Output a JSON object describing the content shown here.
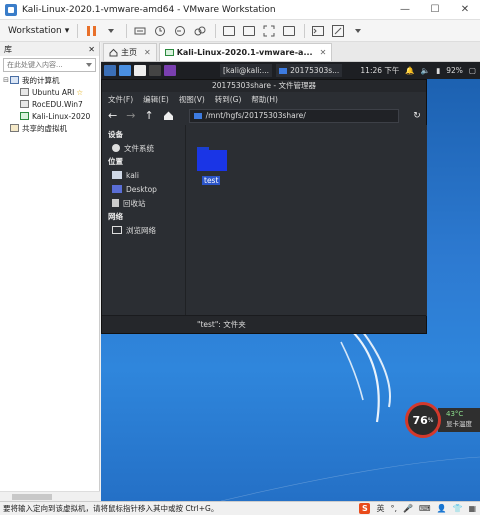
{
  "window": {
    "title": "Kali-Linux-2020.1-vmware-amd64 - VMware Workstation",
    "controls": [
      "—",
      "☐",
      "✕"
    ]
  },
  "toolbar": {
    "menu_label": "Workstation",
    "menu_arrow": "▾"
  },
  "library": {
    "title": "库",
    "close": "✕",
    "search_placeholder": "在此处键入内容...",
    "my_computer": "我的计算机",
    "vms": [
      "Ubuntu ARI",
      "RocEDU.Win7",
      "Kali-Linux-2020"
    ],
    "shared": "共享的虚拟机"
  },
  "tabs": [
    {
      "label": "主页"
    },
    {
      "label": "Kali-Linux-2020.1-vmware-a..."
    }
  ],
  "kali_panel": {
    "terminal_task": "[kali@kali:...",
    "folder_task": "20175303s...",
    "clock": "11:26 下午",
    "battery": "92%"
  },
  "file_manager": {
    "title": "20175303share - 文件管理器",
    "menu": [
      "文件(F)",
      "编辑(E)",
      "视图(V)",
      "转到(G)",
      "帮助(H)"
    ],
    "path": "/mnt/hgfs/20175303share/",
    "side": {
      "devices_head": "设备",
      "filesystem": "文件系统",
      "places_head": "位置",
      "kali": "kali",
      "desktop": "Desktop",
      "trash": "回收站",
      "network_head": "网络",
      "browse_network": "浏览网络"
    },
    "folder_name": "test",
    "status": "\"test\": 文件夹"
  },
  "temp_widget": {
    "usage": "76",
    "usage_unit": "%",
    "gpu_temp": "43°C",
    "gpu_label": "显卡温度"
  },
  "statusbar": {
    "message": "要将输入定向到该虚拟机，请将鼠标指针移入其中或按 Ctrl+G。",
    "ime_label": "英"
  },
  "colors": {
    "vm_desktop": "#2d7ad1",
    "kali_panel": "#1d1f23",
    "file_manager_bg": "#2b2e33",
    "folder_blue": "#1a35e6",
    "accent_orange": "#e8702a"
  }
}
